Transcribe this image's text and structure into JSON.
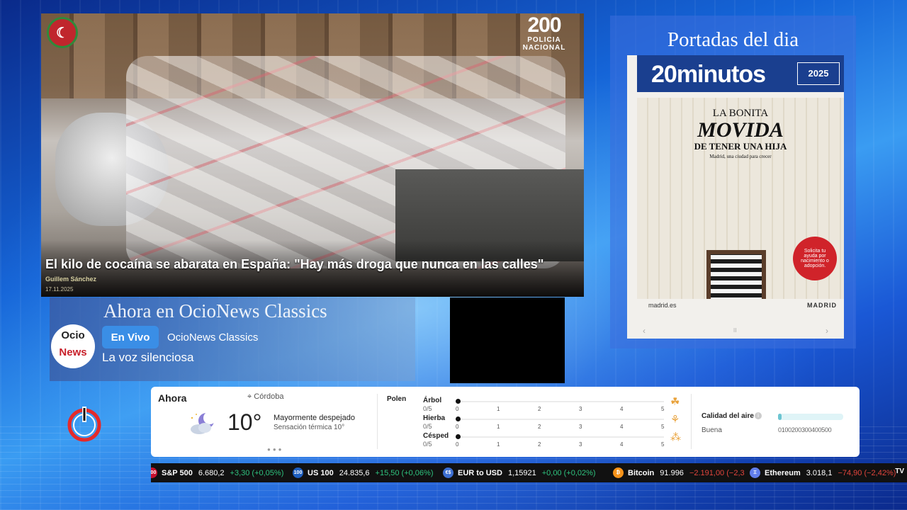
{
  "video": {
    "headline": "El kilo de cocaína se abarata en España: \"Hay más droga que nunca en las calles\"",
    "author": "Guillem Sánchez",
    "date": "17.11.2025",
    "watermark_number": "200",
    "watermark_name": "POLICIA NACIONAL"
  },
  "covers": {
    "title": "Portadas del dia",
    "paper_name": "20minutos",
    "paper_year": "2025",
    "headline_a": "LA BONITA",
    "headline_b": "MOVIDA",
    "headline_c": "DE TENER UNA HIJA",
    "headline_d": "Madrid, una ciudad para crecer",
    "promo_text": "Solicita tu ayuda por nacimiento o adopción.",
    "footer_left": "madrid.es",
    "footer_right": "MADRID",
    "nav_prev": "‹",
    "nav_next": "›",
    "nav_mid": "II"
  },
  "now": {
    "title": "Ahora en OcioNews Classics",
    "logo_top": "Ocio",
    "logo_bottom": "News",
    "live_label": "En Vivo",
    "channel": "OcioNews Classics",
    "program": "La voz silenciosa"
  },
  "weather": {
    "now_label": "Ahora",
    "location": "Córdoba",
    "temperature": "10°",
    "description": "Mayormente despejado",
    "feels_like": "Sensación térmica 10°",
    "icon": "partly-cloudy-night-icon",
    "pollen_label": "Polen",
    "pollen": [
      {
        "name": "Árbol",
        "value": "0/5",
        "icon": "tree-icon"
      },
      {
        "name": "Hierba",
        "value": "0/5",
        "icon": "grass-icon"
      },
      {
        "name": "Césped",
        "value": "0/5",
        "icon": "lawn-icon"
      }
    ],
    "pollen_scale": [
      "0",
      "1",
      "2",
      "3",
      "4",
      "5"
    ],
    "air_title": "Calidad del aire",
    "air_level": "Buena",
    "air_scale": "0100200300400500",
    "air_value_fraction": 0.05
  },
  "ticker": [
    {
      "badge": "500",
      "symbol": "S&P 500",
      "price": "6.680,2",
      "change": "+3,30 (+0,05%)",
      "trend": "up",
      "badge_color": "#c8102e"
    },
    {
      "badge": "100",
      "symbol": "US 100",
      "price": "24.835,6",
      "change": "+15,50 (+0,06%)",
      "trend": "up",
      "badge_color": "#1f5fbf"
    },
    {
      "badge": "€$",
      "symbol": "EUR to USD",
      "price": "1,15921",
      "change": "+0,00 (+0,02%)",
      "trend": "up",
      "badge_color": "#3d6fd1"
    },
    {
      "badge": "₿",
      "symbol": "Bitcoin",
      "price": "91.996",
      "change": "−2.191,00 (−2,3",
      "trend": "down",
      "badge_color": "#f7931a"
    },
    {
      "badge": "Ξ",
      "symbol": "Ethereum",
      "price": "3.018,1",
      "change": "−74,90 (−2,42%)",
      "trend": "down",
      "badge_color": "#627eea"
    }
  ],
  "ticker_brand": "TV"
}
